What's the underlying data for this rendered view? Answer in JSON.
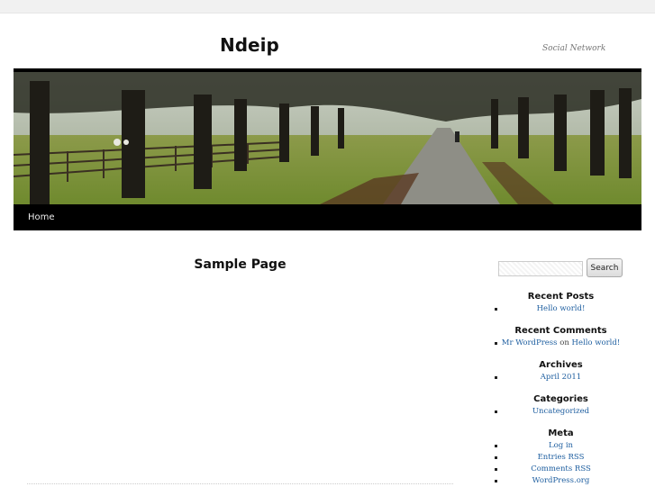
{
  "site": {
    "title": "Ndeip",
    "description": "Social Network"
  },
  "nav": {
    "home": "Home"
  },
  "page": {
    "title": "Sample Page"
  },
  "search": {
    "button": "Search",
    "value": ""
  },
  "widgets": {
    "recent_posts": {
      "title": "Recent Posts",
      "items": [
        "Hello world!"
      ]
    },
    "recent_comments": {
      "title": "Recent Comments",
      "author": "Mr WordPress",
      "joiner": "on",
      "post": "Hello world!"
    },
    "archives": {
      "title": "Archives",
      "items": [
        "April 2011"
      ]
    },
    "categories": {
      "title": "Categories",
      "items": [
        "Uncategorized"
      ]
    },
    "meta": {
      "title": "Meta",
      "items": [
        "Log in",
        "Entries RSS",
        "Comments RSS",
        "WordPress.org"
      ]
    }
  },
  "banner": {
    "description_icon": "tree-lined-road-image"
  },
  "colors": {
    "link": "#1f5fa0",
    "nav_bg": "#000000",
    "topbar": "#f1f1f1"
  }
}
